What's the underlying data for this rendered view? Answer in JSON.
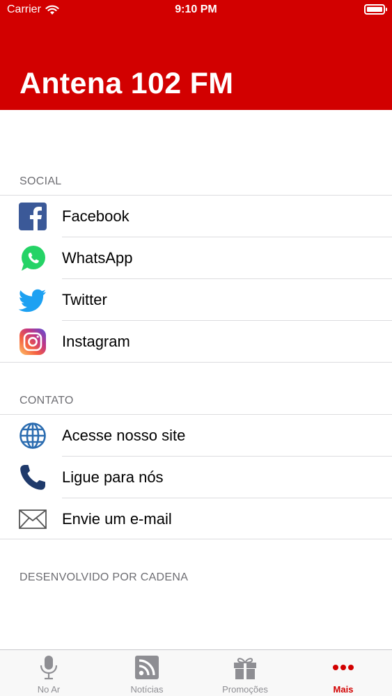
{
  "status_bar": {
    "carrier": "Carrier",
    "time": "9:10 PM"
  },
  "header": {
    "title": "Antena 102 FM",
    "color": "#d20000"
  },
  "social": {
    "header": "SOCIAL",
    "items": [
      {
        "label": "Facebook",
        "icon": "facebook-icon"
      },
      {
        "label": "WhatsApp",
        "icon": "whatsapp-icon"
      },
      {
        "label": "Twitter",
        "icon": "twitter-icon"
      },
      {
        "label": "Instagram",
        "icon": "instagram-icon"
      }
    ]
  },
  "contato": {
    "header": "CONTATO",
    "items": [
      {
        "label": "Acesse nosso site",
        "icon": "globe-icon"
      },
      {
        "label": "Ligue para nós",
        "icon": "phone-icon"
      },
      {
        "label": "Envie um e-mail",
        "icon": "mail-icon"
      }
    ]
  },
  "footer_note": "DESENVOLVIDO POR CADENA",
  "tabbar": {
    "tabs": [
      {
        "label": "No Ar",
        "icon": "microphone-icon",
        "active": false
      },
      {
        "label": "Notícias",
        "icon": "rss-icon",
        "active": false
      },
      {
        "label": "Promoções",
        "icon": "gift-icon",
        "active": false
      },
      {
        "label": "Mais",
        "icon": "more-icon",
        "active": true
      }
    ],
    "active_color": "#d20000",
    "inactive_color": "#8e8e93"
  }
}
